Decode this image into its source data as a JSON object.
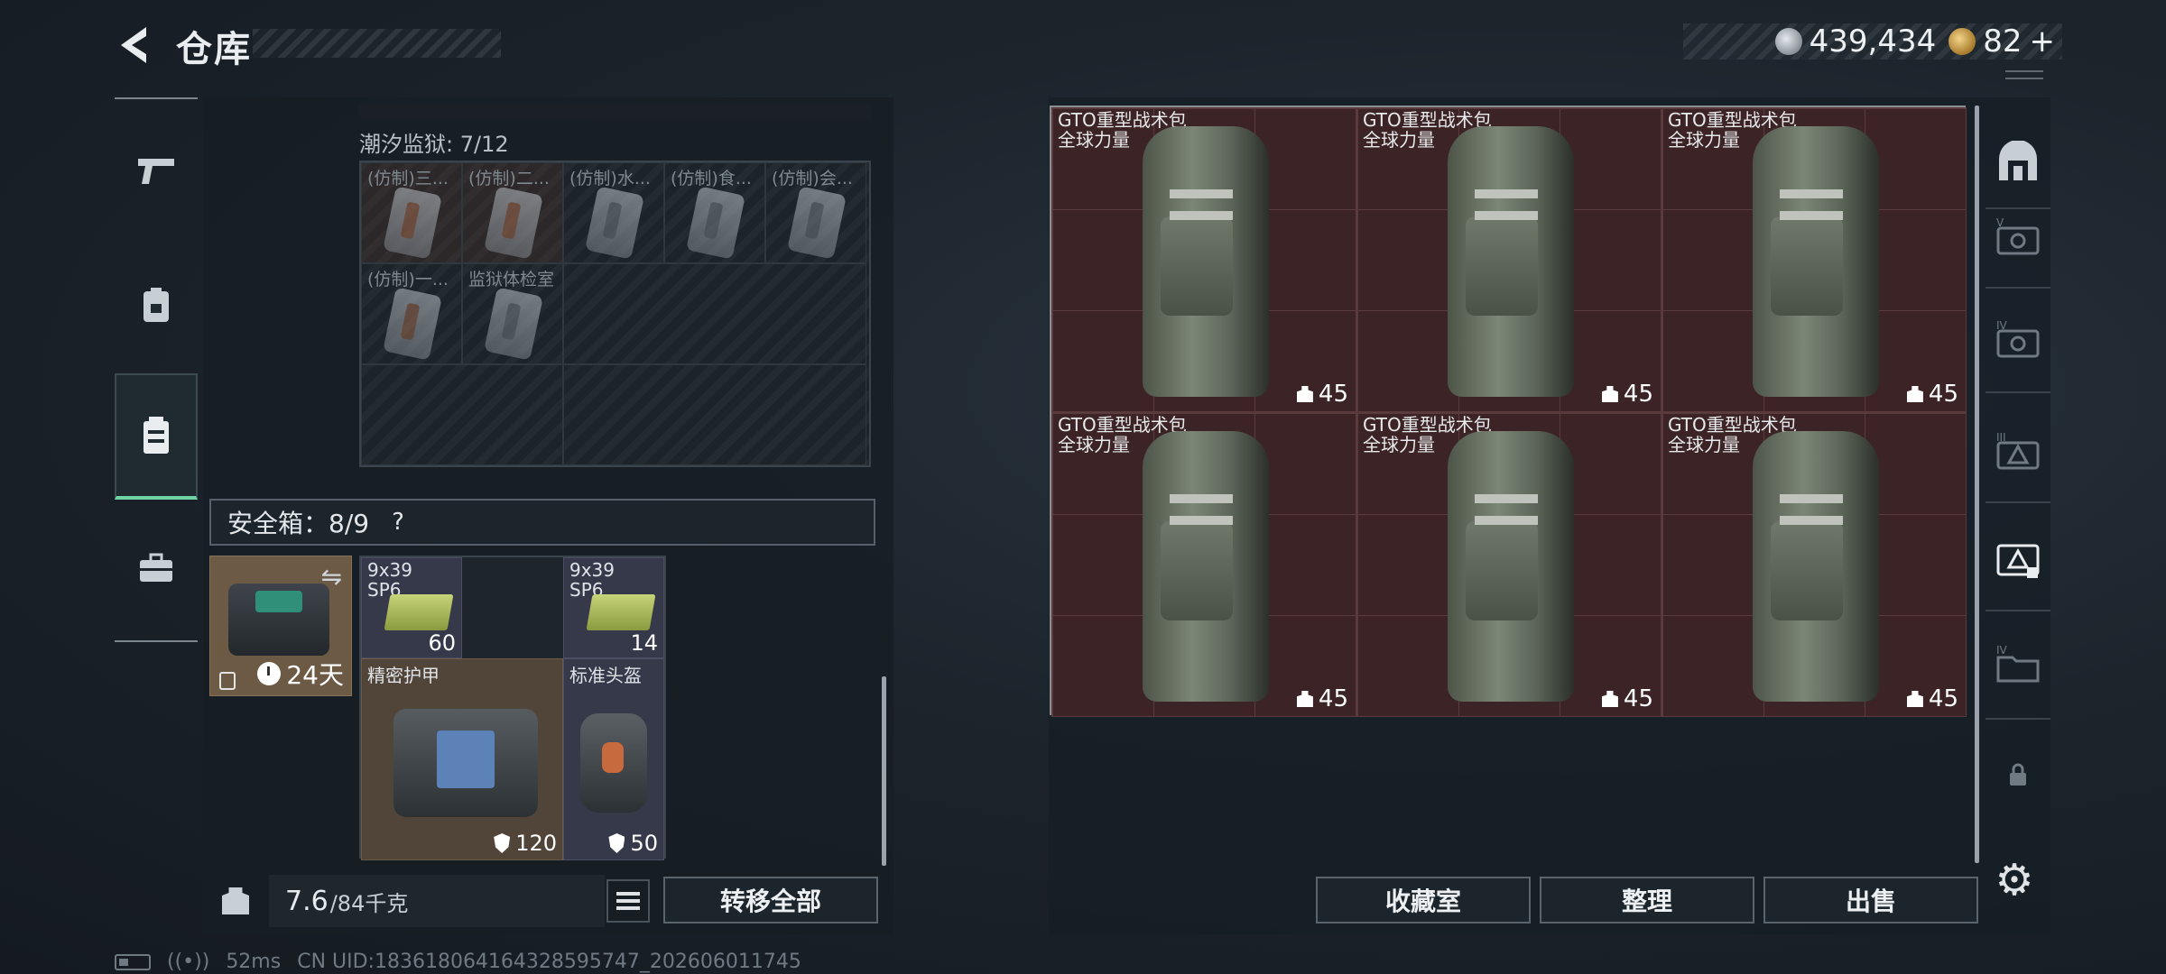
{
  "header": {
    "title": "仓库",
    "currency": [
      {
        "icon": "silver-coin-icon",
        "value": "439,434"
      },
      {
        "icon": "gold-coin-icon",
        "value": "82"
      }
    ],
    "add_symbol": "+"
  },
  "left_rail": {
    "items": [
      {
        "icon": "pistol-icon"
      },
      {
        "icon": "armor-vest-icon"
      },
      {
        "icon": "backpack-icon",
        "active": true
      },
      {
        "icon": "briefcase-icon"
      }
    ]
  },
  "container": {
    "label": "潮汐监狱: 7/12",
    "items": [
      {
        "name": "(仿制)三..."
      },
      {
        "name": "(仿制)二..."
      },
      {
        "name": "(仿制)水..."
      },
      {
        "name": "(仿制)食..."
      },
      {
        "name": "(仿制)会..."
      },
      {
        "name": "(仿制)一..."
      },
      {
        "name": "监狱体检室"
      }
    ]
  },
  "safe_box": {
    "label": "安全箱：8/9",
    "help": "?",
    "days": "24天",
    "ammo": [
      {
        "name": "9x39\nSP6",
        "count": "60"
      },
      {
        "name": "9x39\nSP6",
        "count": "14"
      }
    ],
    "armor": {
      "name": "精密护甲",
      "durability": "120"
    },
    "helmet": {
      "name": "标准头盔",
      "durability": "50"
    }
  },
  "bottom_left": {
    "weight_current": "7.6",
    "weight_max": "/84千克",
    "transfer_all": "转移全部"
  },
  "backpacks": [
    {
      "name": "GTO重型战术包",
      "sub": "全球力量",
      "weight": "45"
    },
    {
      "name": "GTO重型战术包",
      "sub": "全球力量",
      "weight": "45"
    },
    {
      "name": "GTO重型战术包",
      "sub": "全球力量",
      "weight": "45"
    },
    {
      "name": "GTO重型战术包",
      "sub": "全球力量",
      "weight": "45"
    },
    {
      "name": "GTO重型战术包",
      "sub": "全球力量",
      "weight": "45"
    },
    {
      "name": "GTO重型战术包",
      "sub": "全球力量",
      "weight": "45"
    }
  ],
  "bottom_right": {
    "collection": "收藏室",
    "sort": "整理",
    "sell": "出售"
  },
  "right_rail": {
    "items": [
      {
        "icon": "helmet-slot-icon"
      },
      {
        "icon": "tier-v-case-icon",
        "tier": "V"
      },
      {
        "icon": "tier-iv-case-icon",
        "tier": "IV"
      },
      {
        "icon": "tier-iii-case-icon",
        "tier": "III"
      },
      {
        "icon": "tier-ii-case-icon",
        "active": true
      },
      {
        "icon": "tier-iv-folder-icon",
        "tier": "IV"
      },
      {
        "icon": "lock-icon"
      }
    ]
  },
  "status": {
    "ping": "52ms",
    "uid": "CN UID:18361806416432859574​7_202606011745"
  }
}
